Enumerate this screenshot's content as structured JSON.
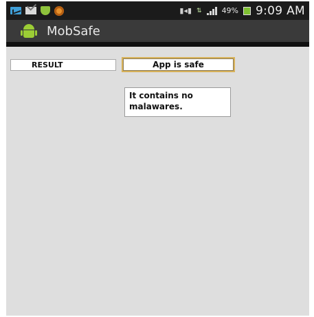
{
  "status_bar": {
    "notification_icons": [
      "message-icon",
      "mail-icon",
      "shield-icon",
      "app-icon"
    ],
    "battery_percent": "49%",
    "time": "9:09 AM",
    "battery_color": "#7fc032"
  },
  "action_bar": {
    "title": "MobSafe",
    "icon": "android-icon"
  },
  "main": {
    "label": "RESULT",
    "result_value": "App is safe",
    "detail": "It contains no malawares."
  },
  "colors": {
    "action_bar_bg": "#3a3a3a",
    "content_bg": "#dedede",
    "result_border": "#d8b25a"
  }
}
